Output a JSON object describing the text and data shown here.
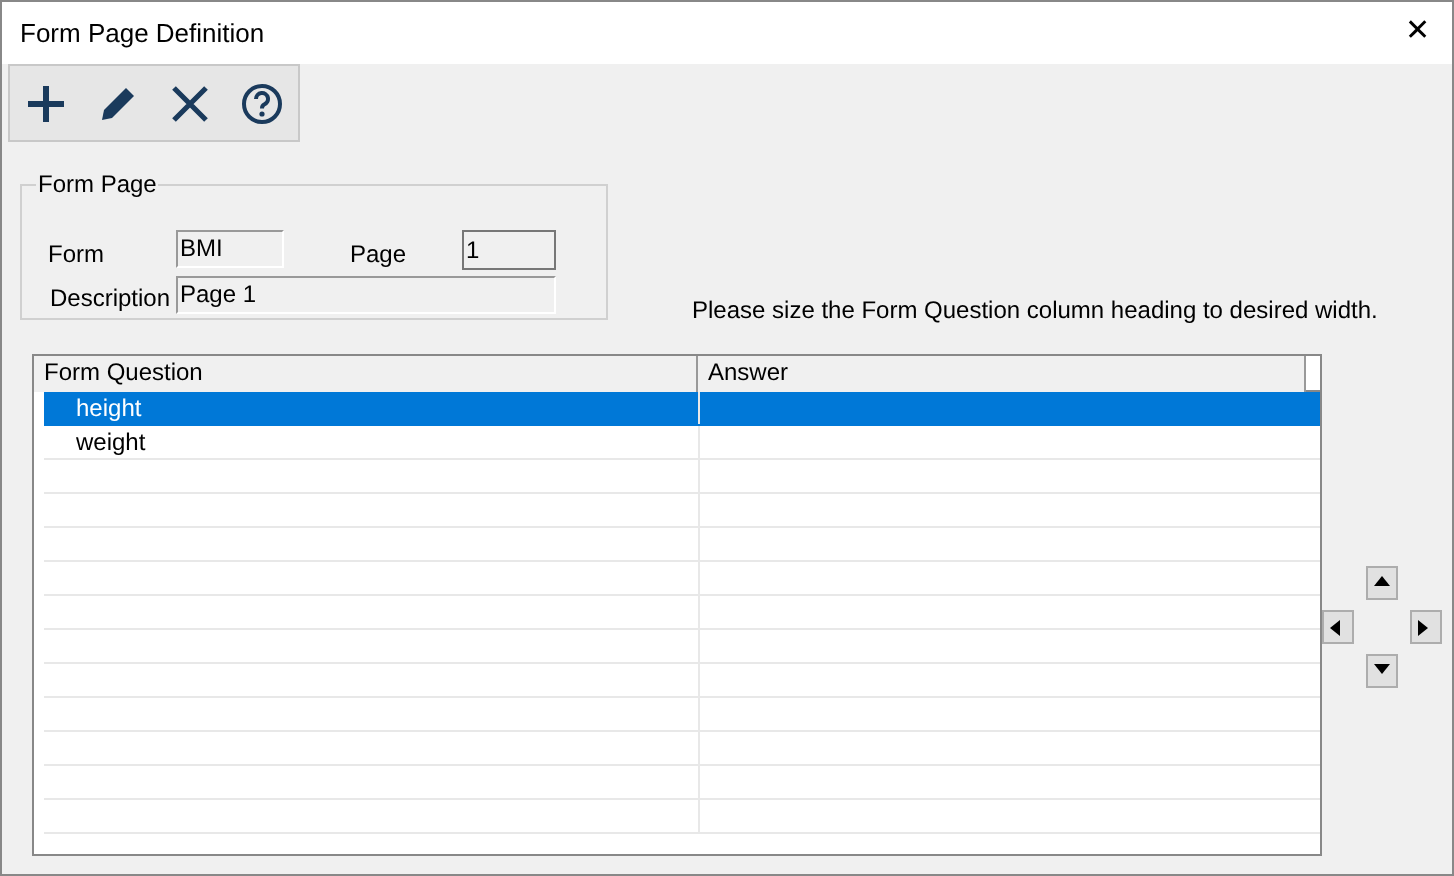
{
  "window": {
    "title": "Form Page Definition",
    "close": "✕"
  },
  "toolbar": [
    {
      "kind": "add"
    },
    {
      "kind": "edit"
    },
    {
      "kind": "delete"
    },
    {
      "kind": "help"
    }
  ],
  "form_page": {
    "title": "Form Page",
    "form_label": "Form",
    "form_value": "BMI",
    "page_label": "Page",
    "page_value": "1",
    "description_label": "Description",
    "description_value": "Page 1"
  },
  "hint": "Please size the Form Question column heading to desired width.",
  "table": {
    "columns": [
      "Form Question",
      "Answer"
    ],
    "rows": [
      {
        "question": "height",
        "selected": true
      },
      {
        "question": "weight",
        "selected": false
      }
    ]
  },
  "arrows": [
    {
      "kind": "up"
    },
    {
      "kind": "left"
    },
    {
      "kind": "right"
    },
    {
      "kind": "down"
    }
  ]
}
